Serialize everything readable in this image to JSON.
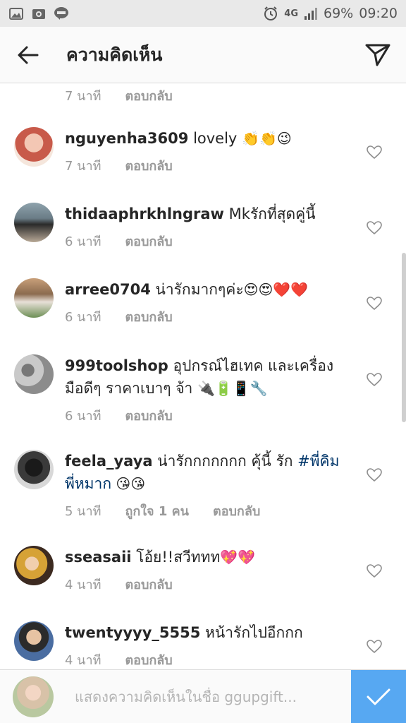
{
  "status_bar": {
    "network": "4G",
    "battery": "69%",
    "time": "09:20",
    "left_icons": [
      "image-icon",
      "camera-icon",
      "line-icon"
    ]
  },
  "header": {
    "title": "ความคิดเห็น"
  },
  "partial_comment": {
    "time": "7 นาที",
    "reply": "ตอบกลับ"
  },
  "comments": [
    {
      "username": "nguyenha3609",
      "text": " lovely ",
      "emoji": "👏👏😉",
      "time": "7 นาที",
      "reply": "ตอบกลับ"
    },
    {
      "username": "thidaaphrkhlngraw",
      "text": " Mkรักที่สุดคู่นี้",
      "time": "6 นาที",
      "reply": "ตอบกลับ"
    },
    {
      "username": "arree0704",
      "text": " น่ารักมากๆค่ะ",
      "emoji": "😍😍❤️❤️",
      "time": "6 นาที",
      "reply": "ตอบกลับ"
    },
    {
      "username": "999toolshop",
      "text": " อุปกรณ์ไฮเทค และเครื่องมือดีๆ ราคาเบาๆ จ้า ",
      "emoji": "🔌🔋📱🔧",
      "time": "6 นาที",
      "reply": "ตอบกลับ"
    },
    {
      "username": "feela_yaya",
      "text": " น่ารักกกกกกก คุ้นี้ รัก ",
      "hashtag": "#พี่คิมพี่หมาก",
      "emoji": " 😘😘",
      "time": "5 นาที",
      "likes": "ถูกใจ 1 คน",
      "reply": "ตอบกลับ"
    },
    {
      "username": "sseasaii",
      "text": " โอ้ย!!สวีททท",
      "emoji": "💖💖",
      "time": "4 นาที",
      "reply": "ตอบกลับ"
    },
    {
      "username": "twentyyyy_5555",
      "text": " หน้ารักไปอีกกก",
      "time": "4 นาที",
      "reply": "ตอบกลับ"
    }
  ],
  "composer": {
    "placeholder": "แสดงความคิดเห็นในชื่อ ggupgift..."
  },
  "colors": {
    "accent": "#57a8f2",
    "hashtag": "#003569",
    "meta": "#999999"
  }
}
